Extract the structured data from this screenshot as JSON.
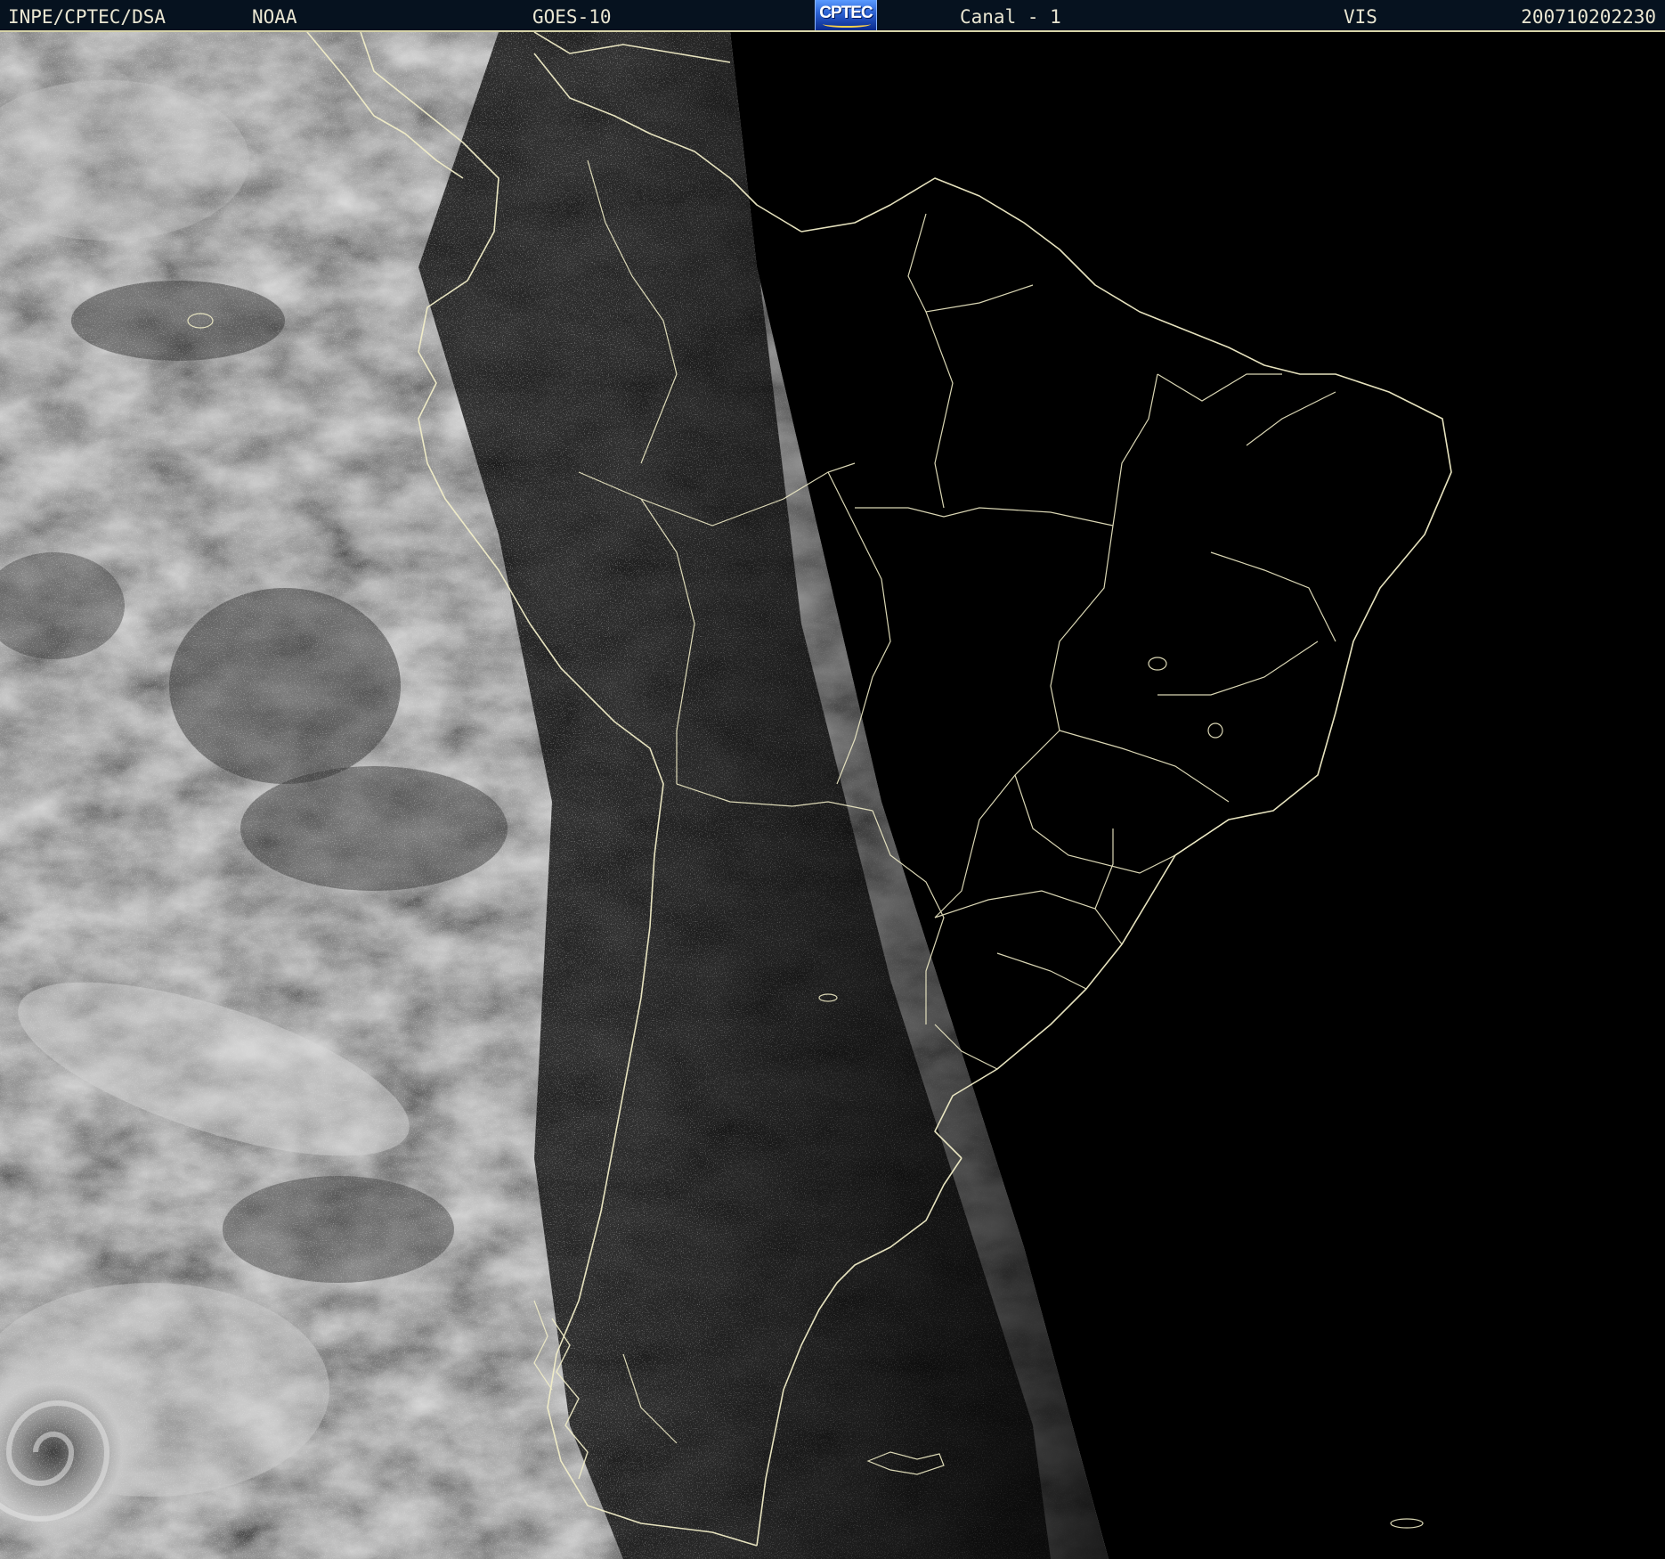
{
  "header": {
    "agency": "INPE/CPTEC/DSA",
    "operator": "NOAA",
    "satellite": "GOES-10",
    "logo_text": "CPTEC",
    "channel": "Canal - 1",
    "band": "VIS",
    "timestamp": "200710202230"
  },
  "colors": {
    "header_bg": "#06121f",
    "header_text": "#e9e6d2",
    "coastline": "#f2eec8",
    "night_side": "#000000"
  },
  "image": {
    "type": "satellite-visible-imagery",
    "region": "South America"
  }
}
